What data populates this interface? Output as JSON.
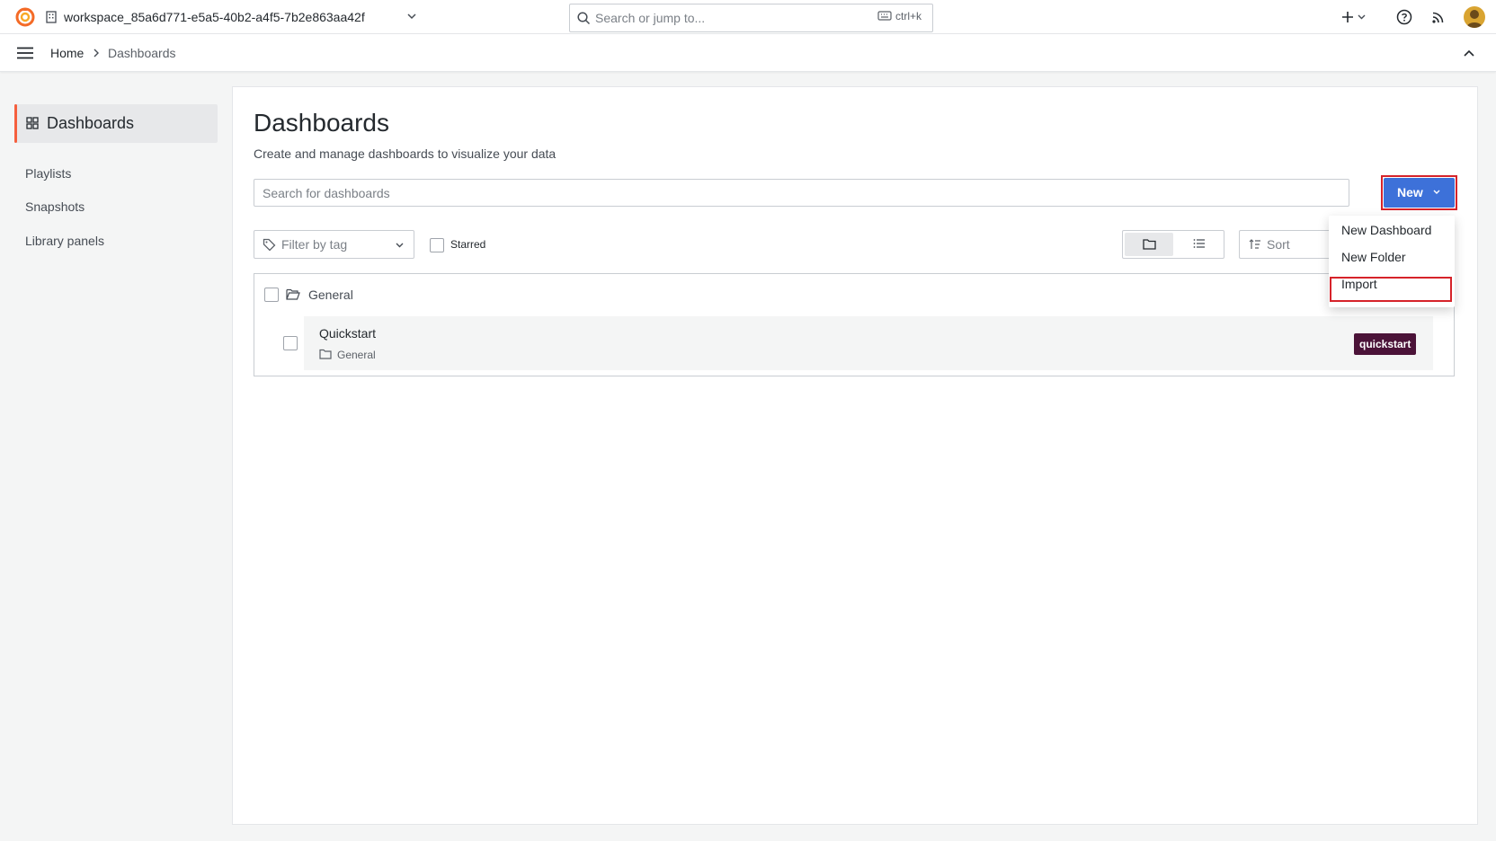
{
  "topbar": {
    "workspace": "workspace_85a6d771-e5a5-40b2-a4f5-7b2e863aa42f",
    "search_placeholder": "Search or jump to...",
    "search_shortcut": "ctrl+k"
  },
  "breadcrumb": {
    "home": "Home",
    "current": "Dashboards"
  },
  "sidebar": {
    "active": "Dashboards",
    "items": [
      {
        "label": "Playlists"
      },
      {
        "label": "Snapshots"
      },
      {
        "label": "Library panels"
      }
    ]
  },
  "main": {
    "title": "Dashboards",
    "subtitle": "Create and manage dashboards to visualize your data",
    "search_placeholder": "Search for dashboards",
    "new_button": "New",
    "filter_by_tag": "Filter by tag",
    "starred": "Starred",
    "sort": "Sort"
  },
  "new_menu": {
    "items": [
      "New Dashboard",
      "New Folder",
      "Import"
    ]
  },
  "folders": [
    {
      "name": "General",
      "dashboards": [
        {
          "title": "Quickstart",
          "folder": "General",
          "tag": "quickstart"
        }
      ]
    }
  ],
  "colors": {
    "accent": "#3d71d9",
    "brand": "#f55f3e",
    "highlight": "#d6232a",
    "tag_bg": "#4b1338"
  }
}
